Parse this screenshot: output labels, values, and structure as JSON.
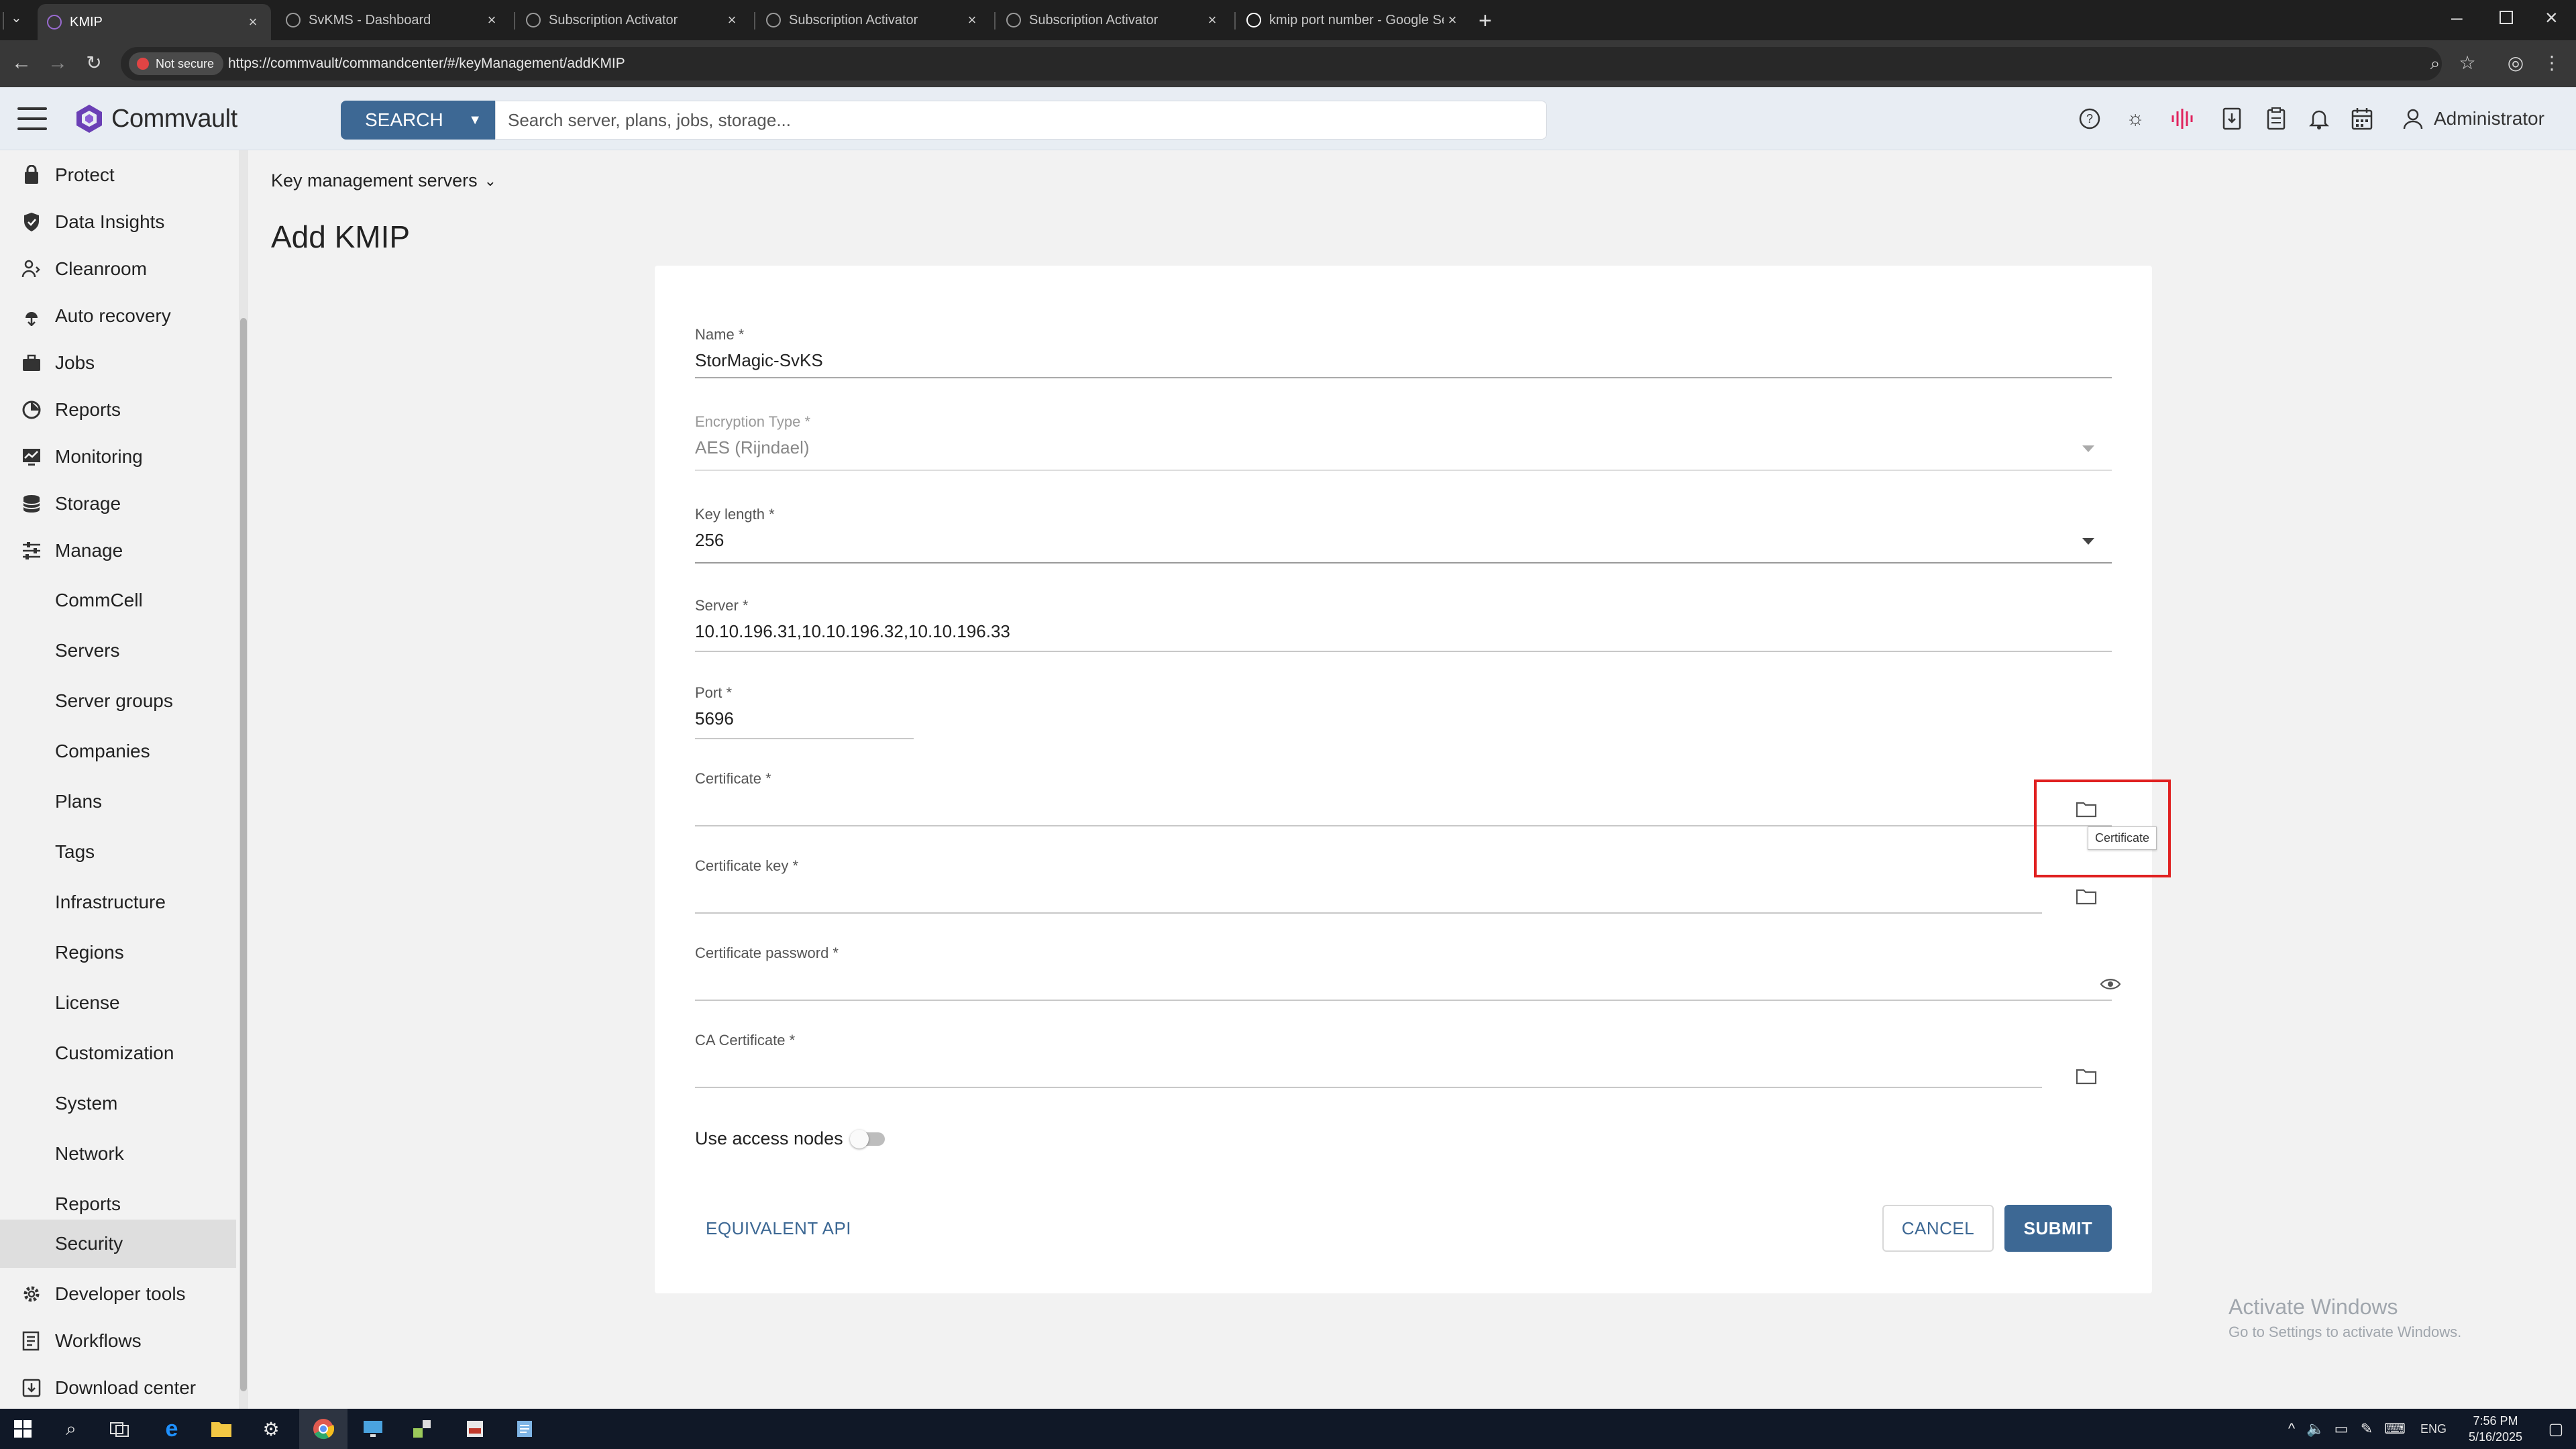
{
  "browser": {
    "tabs": [
      {
        "title": "KMIP",
        "active": true
      },
      {
        "title": "SvKMS - Dashboard",
        "active": false
      },
      {
        "title": "Subscription Activator",
        "active": false
      },
      {
        "title": "Subscription Activator",
        "active": false
      },
      {
        "title": "Subscription Activator",
        "active": false
      },
      {
        "title": "kmip port number - Google Se",
        "active": false
      }
    ],
    "not_secure": "Not secure",
    "url": "https://commvault/commandcenter/#/keyManagement/addKMIP"
  },
  "header": {
    "brand": "Commvault",
    "search_label": "SEARCH",
    "search_placeholder": "Search server, plans, jobs, storage...",
    "user": "Administrator"
  },
  "sidebar": {
    "items": [
      {
        "label": "Protect",
        "icon": "protect-icon",
        "level": "top"
      },
      {
        "label": "Data Insights",
        "icon": "shield-icon",
        "level": "top"
      },
      {
        "label": "Cleanroom",
        "icon": "cleanroom-icon",
        "level": "top"
      },
      {
        "label": "Auto recovery",
        "icon": "auto-recovery-icon",
        "level": "top"
      },
      {
        "label": "Jobs",
        "icon": "briefcase-icon",
        "level": "top"
      },
      {
        "label": "Reports",
        "icon": "reports-icon",
        "level": "top"
      },
      {
        "label": "Monitoring",
        "icon": "monitoring-icon",
        "level": "top"
      },
      {
        "label": "Storage",
        "icon": "database-icon",
        "level": "top"
      },
      {
        "label": "Manage",
        "icon": "sliders-icon",
        "level": "top"
      },
      {
        "label": "CommCell",
        "level": "sub"
      },
      {
        "label": "Servers",
        "level": "sub"
      },
      {
        "label": "Server groups",
        "level": "sub"
      },
      {
        "label": "Companies",
        "level": "sub"
      },
      {
        "label": "Plans",
        "level": "sub"
      },
      {
        "label": "Tags",
        "level": "sub"
      },
      {
        "label": "Infrastructure",
        "level": "sub"
      },
      {
        "label": "Regions",
        "level": "sub"
      },
      {
        "label": "License",
        "level": "sub"
      },
      {
        "label": "Customization",
        "level": "sub"
      },
      {
        "label": "System",
        "level": "sub"
      },
      {
        "label": "Network",
        "level": "sub"
      },
      {
        "label": "Reports",
        "level": "sub"
      },
      {
        "label": "Security",
        "level": "sub",
        "selected": true
      },
      {
        "label": "Developer tools",
        "icon": "gear-icon",
        "level": "top"
      },
      {
        "label": "Workflows",
        "icon": "workflow-icon",
        "level": "top"
      },
      {
        "label": "Download center",
        "icon": "download-icon",
        "level": "top"
      }
    ]
  },
  "main": {
    "breadcrumb": "Key management servers",
    "title": "Add KMIP",
    "form": {
      "name": {
        "label": "Name *",
        "value": "StorMagic-SvKS"
      },
      "encryption_type": {
        "label": "Encryption Type *",
        "value": "AES (Rijndael)"
      },
      "key_length": {
        "label": "Key length *",
        "value": "256"
      },
      "server": {
        "label": "Server *",
        "value": "10.10.196.31,10.10.196.32,10.10.196.33"
      },
      "port": {
        "label": "Port *",
        "value": "5696"
      },
      "certificate": {
        "label": "Certificate *",
        "value": ""
      },
      "certificate_key": {
        "label": "Certificate key *",
        "value": ""
      },
      "certificate_password": {
        "label": "Certificate password *",
        "value": ""
      },
      "ca_certificate": {
        "label": "CA Certificate *",
        "value": ""
      },
      "use_access_nodes": {
        "label": "Use access nodes",
        "on": false
      }
    },
    "tooltip": "Certificate",
    "equivalent_api": "EQUIVALENT API",
    "cancel": "CANCEL",
    "submit": "SUBMIT"
  },
  "watermark": {
    "title": "Activate Windows",
    "subtitle": "Go to Settings to activate Windows."
  },
  "taskbar": {
    "lang": "ENG",
    "time": "7:56 PM",
    "date": "5/16/2025"
  },
  "colors": {
    "accent": "#3d6894",
    "highlight": "#e02020"
  }
}
